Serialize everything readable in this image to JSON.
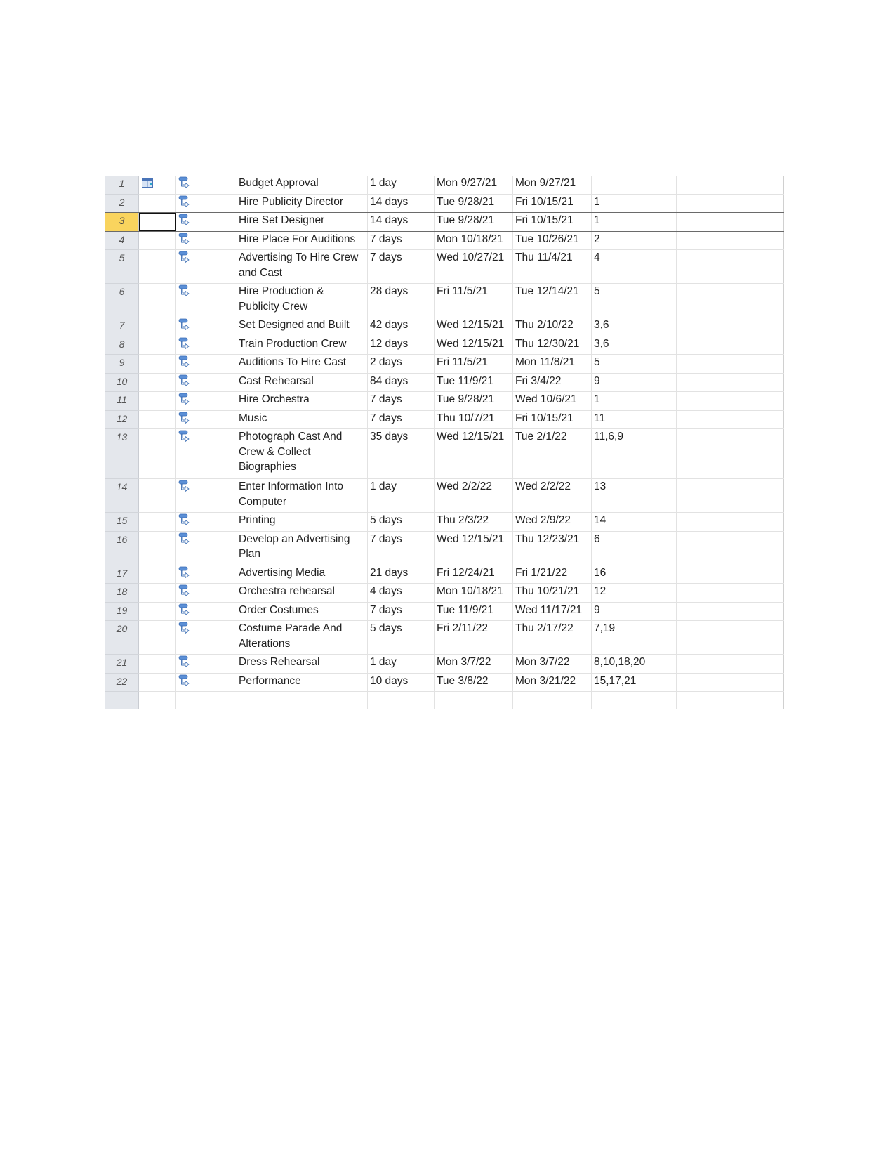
{
  "table": {
    "selected_row": 3,
    "rows": [
      {
        "id": "1",
        "indicator": "calendar-icon",
        "mode": "auto-scheduled-task-icon",
        "name": "Budget Approval",
        "duration": "1 day",
        "start": "Mon 9/27/21",
        "finish": "Mon 9/27/21",
        "predecessors": ""
      },
      {
        "id": "2",
        "indicator": "",
        "mode": "auto-scheduled-task-icon",
        "name": "Hire Publicity Director",
        "duration": "14 days",
        "start": "Tue 9/28/21",
        "finish": "Fri 10/15/21",
        "predecessors": "1"
      },
      {
        "id": "3",
        "indicator": "",
        "mode": "auto-scheduled-task-icon",
        "name": "Hire Set Designer",
        "duration": "14 days",
        "start": "Tue 9/28/21",
        "finish": "Fri 10/15/21",
        "predecessors": "1"
      },
      {
        "id": "4",
        "indicator": "",
        "mode": "auto-scheduled-task-icon",
        "name": "Hire Place For Auditions",
        "duration": "7 days",
        "start": "Mon 10/18/21",
        "finish": "Tue 10/26/21",
        "predecessors": "2"
      },
      {
        "id": "5",
        "indicator": "",
        "mode": "auto-scheduled-task-icon",
        "name": "Advertising To Hire Crew and Cast",
        "duration": "7 days",
        "start": "Wed 10/27/21",
        "finish": "Thu 11/4/21",
        "predecessors": "4"
      },
      {
        "id": "6",
        "indicator": "",
        "mode": "auto-scheduled-task-icon",
        "name": "Hire Production & Publicity Crew",
        "duration": "28 days",
        "start": "Fri 11/5/21",
        "finish": "Tue 12/14/21",
        "predecessors": "5"
      },
      {
        "id": "7",
        "indicator": "",
        "mode": "auto-scheduled-task-icon",
        "name": "Set Designed and Built",
        "duration": "42 days",
        "start": "Wed 12/15/21",
        "finish": "Thu 2/10/22",
        "predecessors": "3,6"
      },
      {
        "id": "8",
        "indicator": "",
        "mode": "auto-scheduled-task-icon",
        "name": "Train Production Crew",
        "duration": "12 days",
        "start": "Wed 12/15/21",
        "finish": "Thu 12/30/21",
        "predecessors": "3,6"
      },
      {
        "id": "9",
        "indicator": "",
        "mode": "auto-scheduled-task-icon",
        "name": "Auditions To Hire Cast",
        "duration": "2 days",
        "start": "Fri 11/5/21",
        "finish": "Mon 11/8/21",
        "predecessors": "5"
      },
      {
        "id": "10",
        "indicator": "",
        "mode": "auto-scheduled-task-icon",
        "name": "Cast Rehearsal",
        "duration": "84 days",
        "start": "Tue 11/9/21",
        "finish": "Fri 3/4/22",
        "predecessors": "9"
      },
      {
        "id": "11",
        "indicator": "",
        "mode": "auto-scheduled-task-icon",
        "name": "Hire Orchestra",
        "duration": "7 days",
        "start": "Tue 9/28/21",
        "finish": "Wed 10/6/21",
        "predecessors": "1"
      },
      {
        "id": "12",
        "indicator": "",
        "mode": "auto-scheduled-task-icon",
        "name": "Music",
        "duration": "7 days",
        "start": "Thu 10/7/21",
        "finish": "Fri 10/15/21",
        "predecessors": "11"
      },
      {
        "id": "13",
        "indicator": "",
        "mode": "auto-scheduled-task-icon",
        "name": "Photograph Cast And Crew & Collect Biographies",
        "duration": "35 days",
        "start": "Wed 12/15/21",
        "finish": "Tue 2/1/22",
        "predecessors": "11,6,9"
      },
      {
        "id": "14",
        "indicator": "",
        "mode": "auto-scheduled-task-icon",
        "name": "Enter Information Into Computer",
        "duration": "1 day",
        "start": "Wed 2/2/22",
        "finish": "Wed 2/2/22",
        "predecessors": "13"
      },
      {
        "id": "15",
        "indicator": "",
        "mode": "auto-scheduled-task-icon",
        "name": "Printing",
        "duration": "5 days",
        "start": "Thu 2/3/22",
        "finish": "Wed 2/9/22",
        "predecessors": "14"
      },
      {
        "id": "16",
        "indicator": "",
        "mode": "auto-scheduled-task-icon",
        "name": "Develop an Advertising Plan",
        "duration": "7 days",
        "start": "Wed 12/15/21",
        "finish": "Thu 12/23/21",
        "predecessors": "6"
      },
      {
        "id": "17",
        "indicator": "",
        "mode": "auto-scheduled-task-icon",
        "name": "Advertising Media",
        "duration": "21 days",
        "start": "Fri 12/24/21",
        "finish": "Fri 1/21/22",
        "predecessors": "16"
      },
      {
        "id": "18",
        "indicator": "",
        "mode": "auto-scheduled-task-icon",
        "name": "Orchestra rehearsal",
        "duration": "4 days",
        "start": "Mon 10/18/21",
        "finish": "Thu 10/21/21",
        "predecessors": "12"
      },
      {
        "id": "19",
        "indicator": "",
        "mode": "auto-scheduled-task-icon",
        "name": "Order Costumes",
        "duration": "7 days",
        "start": "Tue 11/9/21",
        "finish": "Wed 11/17/21",
        "predecessors": "9"
      },
      {
        "id": "20",
        "indicator": "",
        "mode": "auto-scheduled-task-icon",
        "name": "Costume Parade And Alterations",
        "duration": "5 days",
        "start": "Fri 2/11/22",
        "finish": "Thu 2/17/22",
        "predecessors": "7,19"
      },
      {
        "id": "21",
        "indicator": "",
        "mode": "auto-scheduled-task-icon",
        "name": "Dress Rehearsal",
        "duration": "1 day",
        "start": "Mon 3/7/22",
        "finish": "Mon 3/7/22",
        "predecessors": "8,10,18,20"
      },
      {
        "id": "22",
        "indicator": "",
        "mode": "auto-scheduled-task-icon",
        "name": "Performance",
        "duration": "10 days",
        "start": "Tue 3/8/22",
        "finish": "Mon 3/21/22",
        "predecessors": "15,17,21"
      }
    ]
  }
}
